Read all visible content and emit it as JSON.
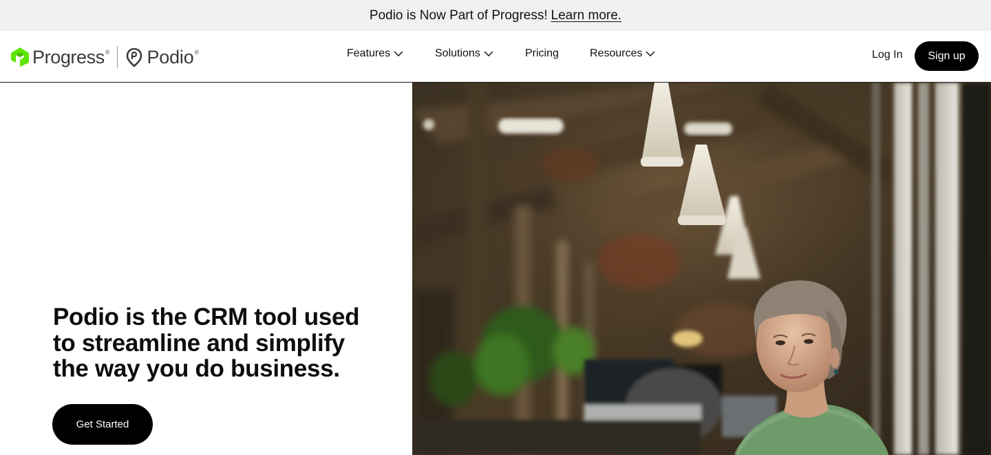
{
  "announcement": {
    "message": "Podio is Now Part of Progress!",
    "link_label": "Learn more."
  },
  "brand": {
    "progress_name": "Progress",
    "podio_name": "Podio",
    "registered_mark": "®",
    "accent_color": "#5ce500"
  },
  "nav": {
    "features": "Features",
    "solutions": "Solutions",
    "pricing": "Pricing",
    "resources": "Resources"
  },
  "auth": {
    "login_label": "Log In",
    "signup_label": "Sign up"
  },
  "hero": {
    "headline": "Podio is the CRM tool used to streamline and simplify the way you do business.",
    "cta_label": "Get Started",
    "image_subject": "smiling woman in green sweater at office desk in an industrial loft"
  },
  "icons": {
    "chevron": "chevron-down-icon",
    "progress_logo": "progress-logo-icon",
    "podio_logo": "podio-logo-icon"
  }
}
